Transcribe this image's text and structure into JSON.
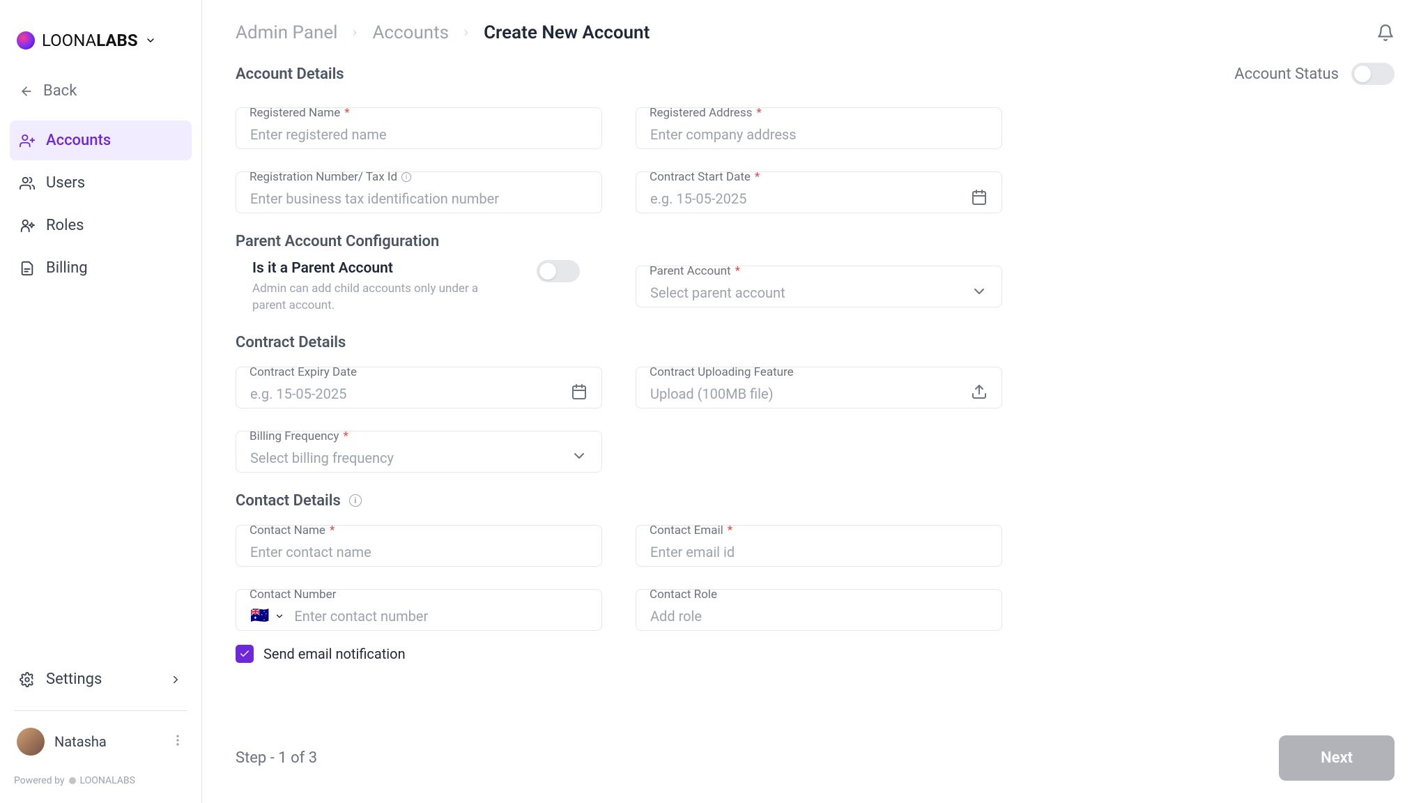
{
  "brand": {
    "name1": "LOONA",
    "name2": "LABS"
  },
  "sidebar": {
    "back": "Back",
    "items": [
      {
        "label": "Accounts"
      },
      {
        "label": "Users"
      },
      {
        "label": "Roles"
      },
      {
        "label": "Billing"
      }
    ],
    "settings": "Settings",
    "user": "Natasha",
    "powered_prefix": "Powered by",
    "powered_brand": "LOONALABS"
  },
  "header": {
    "crumbs": [
      "Admin Panel",
      "Accounts",
      "Create New Account"
    ]
  },
  "status_label": "Account Status",
  "sections": {
    "account_details": "Account Details",
    "parent_config": "Parent Account Configuration",
    "contract_details": "Contract Details",
    "contact_details": "Contact Details"
  },
  "fields": {
    "reg_name": {
      "label": "Registered Name",
      "placeholder": "Enter registered name"
    },
    "reg_address": {
      "label": "Registered Address",
      "placeholder": "Enter company address"
    },
    "tax_id": {
      "label": "Registration Number/ Tax Id",
      "placeholder": "Enter business tax identification number"
    },
    "contract_start": {
      "label": "Contract Start Date",
      "placeholder": "e.g. 15-05-2025"
    },
    "is_parent": {
      "label": "Is it a Parent Account",
      "desc": "Admin can add child accounts only under a parent account."
    },
    "parent_account": {
      "label": "Parent Account",
      "placeholder": "Select parent account"
    },
    "contract_expiry": {
      "label": "Contract Expiry Date",
      "placeholder": "e.g. 15-05-2025"
    },
    "contract_upload": {
      "label": "Contract Uploading Feature",
      "placeholder": "Upload (100MB file)"
    },
    "billing_freq": {
      "label": "Billing Frequency",
      "placeholder": "Select billing frequency"
    },
    "contact_name": {
      "label": "Contact Name",
      "placeholder": "Enter contact name"
    },
    "contact_email": {
      "label": "Contact Email",
      "placeholder": "Enter email id"
    },
    "contact_number": {
      "label": "Contact Number",
      "placeholder": "Enter contact number"
    },
    "contact_role": {
      "label": "Contact Role",
      "placeholder": "Add role"
    }
  },
  "email_notify": "Send email notification",
  "step": "Step - 1 of 3",
  "next": "Next"
}
